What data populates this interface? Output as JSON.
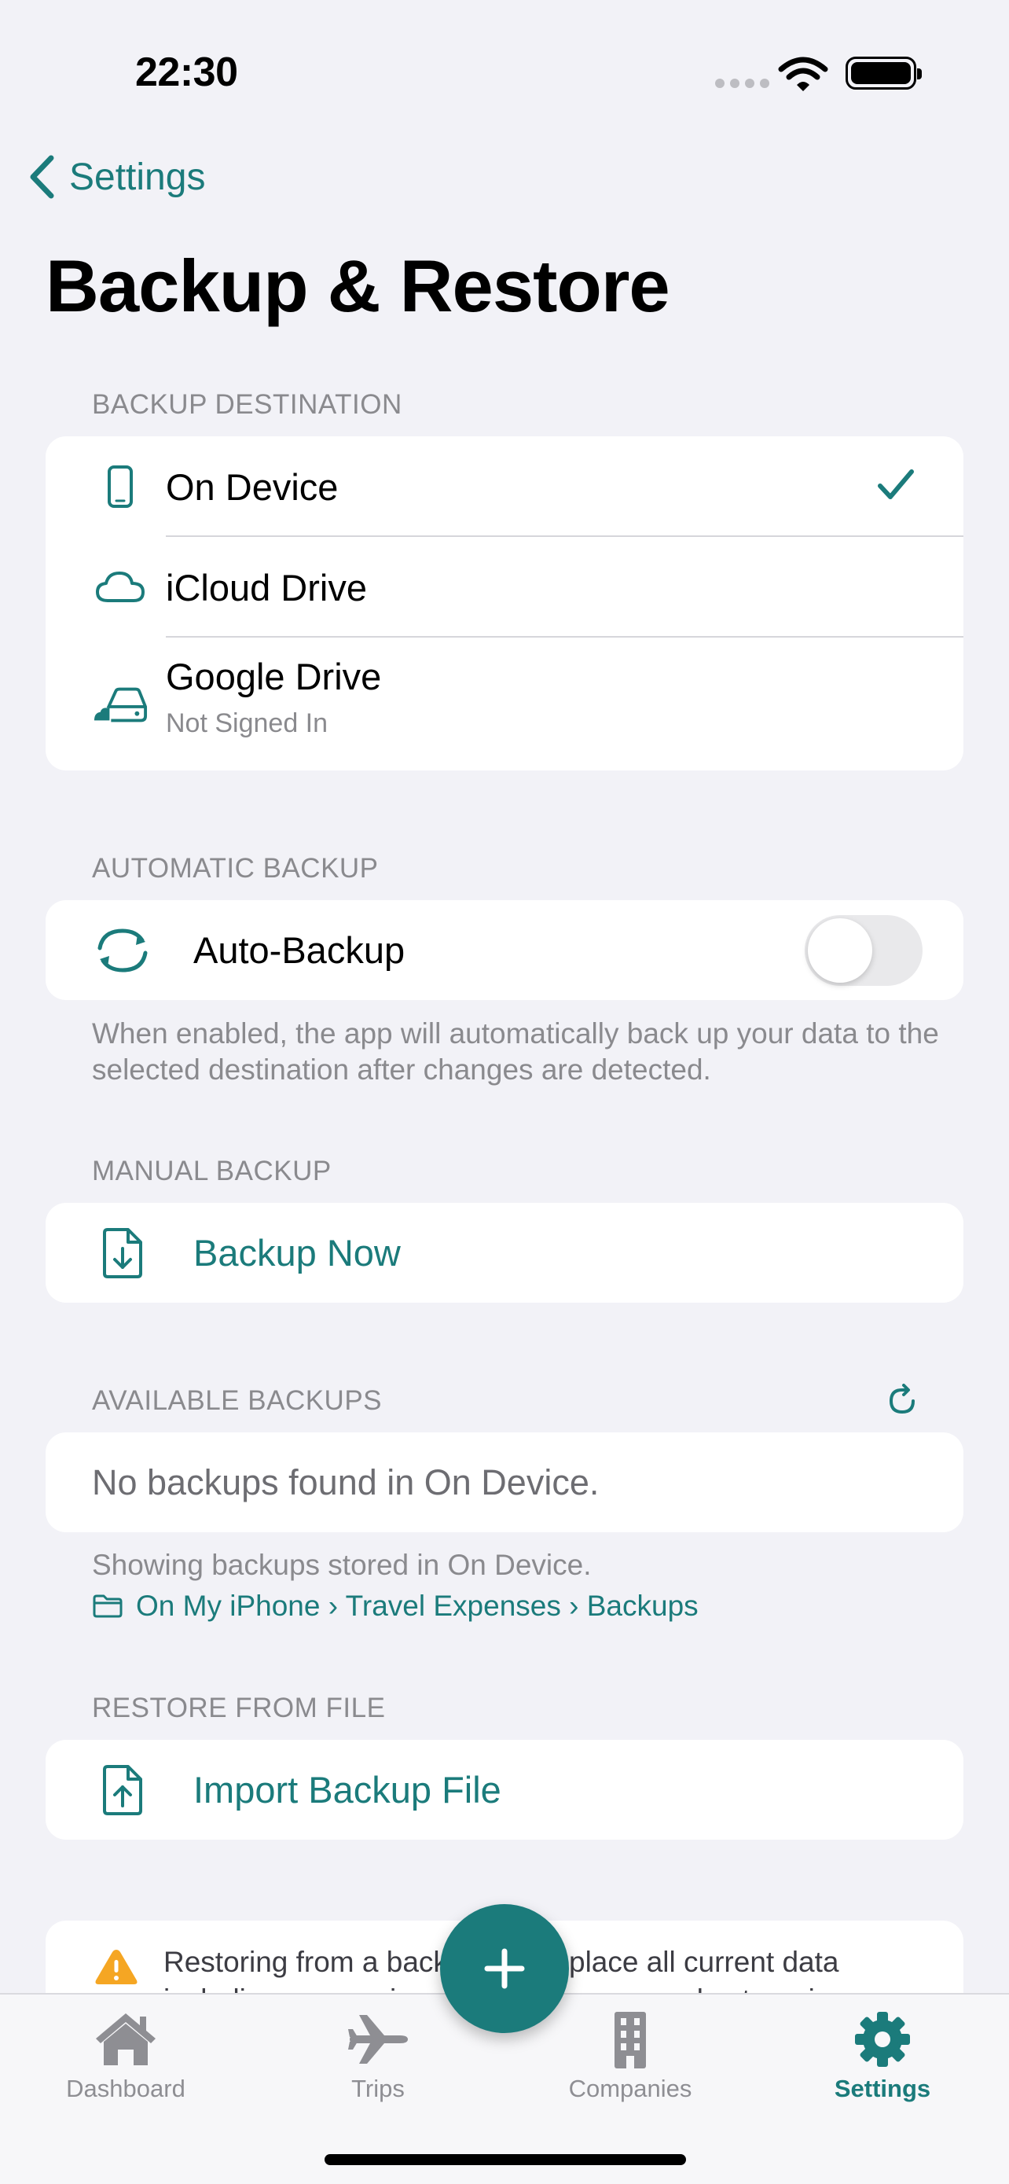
{
  "status_bar": {
    "time": "22:30"
  },
  "nav": {
    "back_label": "Settings",
    "title": "Backup & Restore"
  },
  "backup_destination": {
    "header": "BACKUP DESTINATION",
    "options": [
      {
        "label": "On Device",
        "icon": "phone-icon",
        "selected": true
      },
      {
        "label": "iCloud Drive",
        "icon": "cloud-icon",
        "selected": false
      },
      {
        "label": "Google Drive",
        "sublabel": "Not Signed In",
        "icon": "cloud-drive-icon",
        "selected": false
      }
    ]
  },
  "automatic_backup": {
    "header": "AUTOMATIC BACKUP",
    "label": "Auto-Backup",
    "enabled": false,
    "footer": "When enabled, the app will automatically back up your data to the selected destination after changes are detected."
  },
  "manual_backup": {
    "header": "MANUAL BACKUP",
    "button_label": "Backup Now"
  },
  "available_backups": {
    "header": "AVAILABLE BACKUPS",
    "empty_message": "No backups found in On Device.",
    "footer": "Showing backups stored in On Device.",
    "path": "On My iPhone › Travel Expenses › Backups"
  },
  "restore": {
    "header": "RESTORE FROM FILE",
    "button_label": "Import Backup File"
  },
  "warning": {
    "line1_left": "Restoring from a back",
    "line1_right": "place all current data",
    "line2": "including companies, trips, expenses, and categories."
  },
  "tabs": [
    {
      "label": "Dashboard",
      "icon": "house-icon",
      "active": false
    },
    {
      "label": "Trips",
      "icon": "airplane-icon",
      "active": false
    },
    {
      "label": "Companies",
      "icon": "building-icon",
      "active": false
    },
    {
      "label": "Settings",
      "icon": "gear-icon",
      "active": true
    }
  ],
  "colors": {
    "accent": "#1B7B7B",
    "background": "#F2F2F7",
    "warning": "#F5A623"
  }
}
